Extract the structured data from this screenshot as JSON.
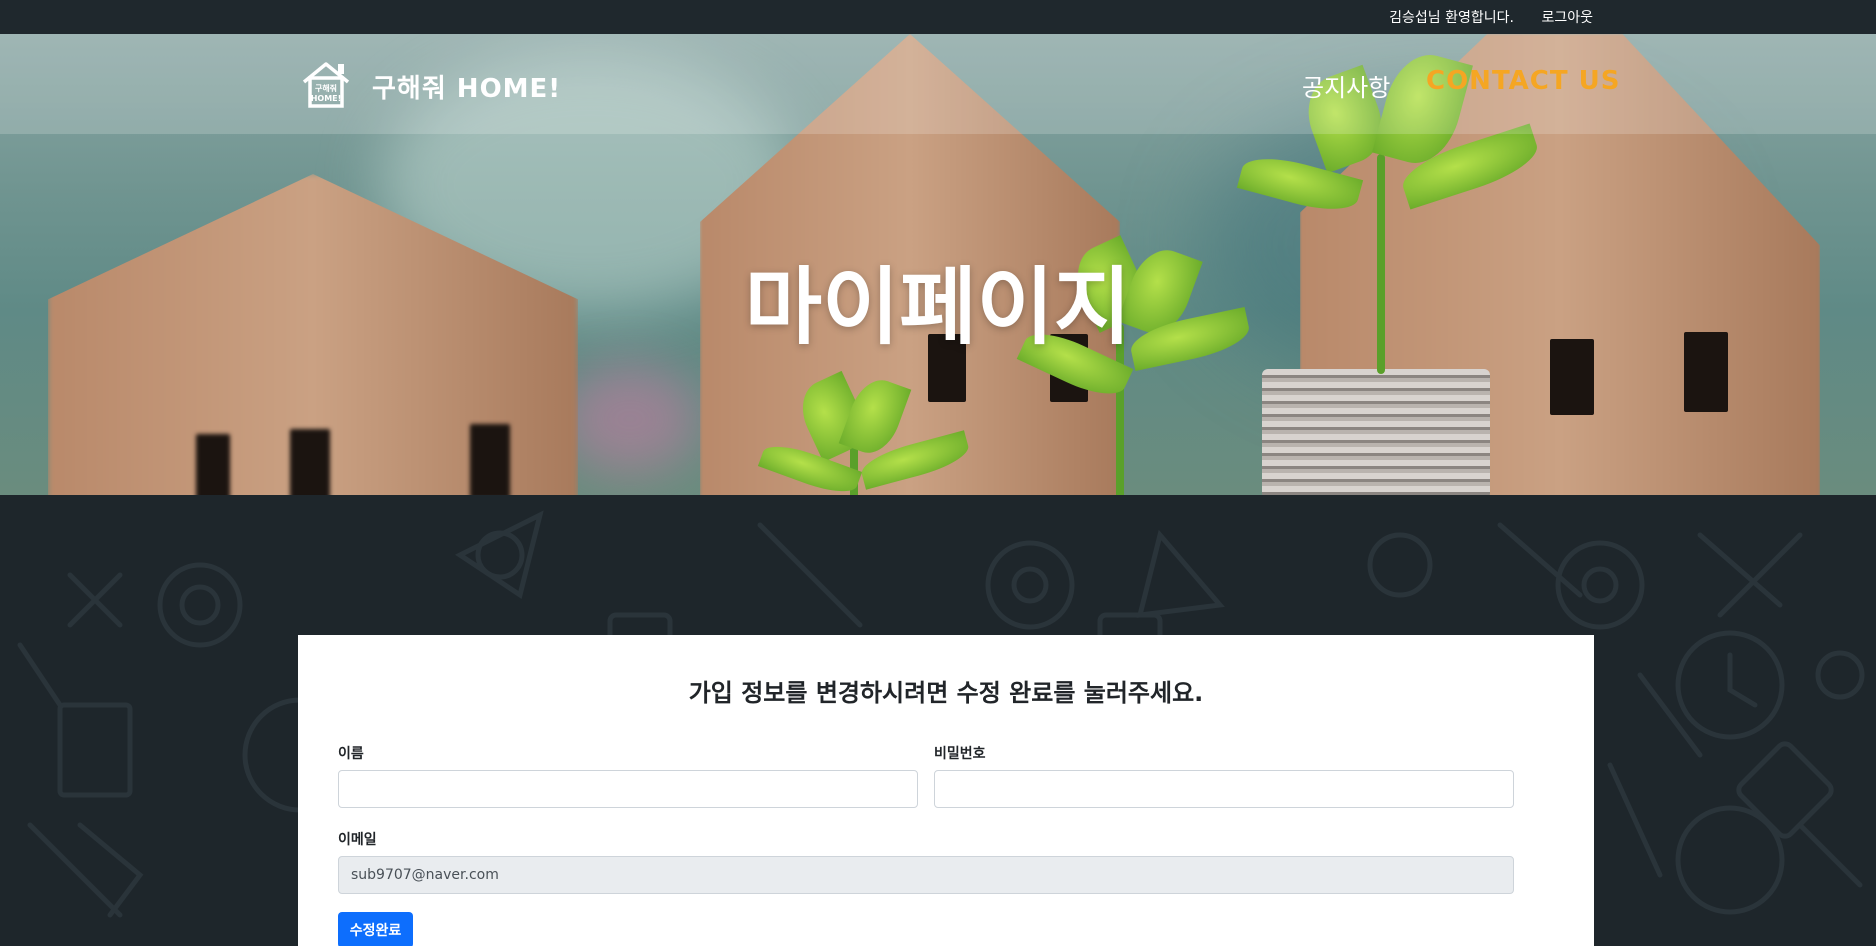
{
  "topbar": {
    "greeting": "김승섭님 환영합니다.",
    "logout_label": "로그아웃"
  },
  "header": {
    "logo_text_line1": "구해줘",
    "logo_text_line2": "HOME!",
    "brand": "구해줘 HOME!",
    "nav_notice": "공지사항",
    "nav_contact": "CONTACT US"
  },
  "hero": {
    "title": "마이페이지"
  },
  "form": {
    "heading": "가입 정보를 변경하시려면 수정 완료를 눌러주세요.",
    "name_label": "이름",
    "name_value": "",
    "password_label": "비밀번호",
    "password_value": "",
    "email_label": "이메일",
    "email_value": "sub9707@naver.com",
    "submit_label": "수정완료"
  },
  "colors": {
    "accent": "#f5a623",
    "button": "#0d6efd",
    "dark_bg": "#1e262b"
  }
}
